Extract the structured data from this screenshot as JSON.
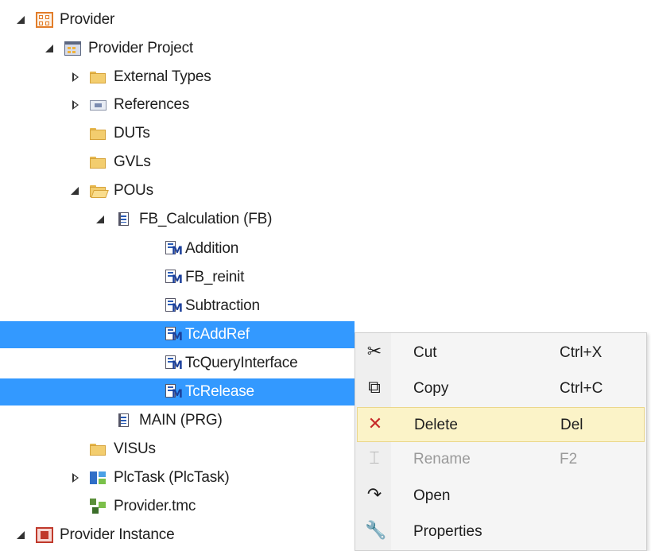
{
  "tree": {
    "items": [
      {
        "label": "Provider",
        "expander": "expanded",
        "icon": "provider-icon",
        "selected": false
      },
      {
        "label": "Provider Project",
        "expander": "expanded",
        "icon": "project-icon",
        "selected": false
      },
      {
        "label": "External Types",
        "expander": "collapsed",
        "icon": "folder-icon",
        "selected": false
      },
      {
        "label": "References",
        "expander": "collapsed",
        "icon": "references-icon",
        "selected": false
      },
      {
        "label": "DUTs",
        "expander": "none",
        "icon": "folder-icon",
        "selected": false
      },
      {
        "label": "GVLs",
        "expander": "none",
        "icon": "folder-icon",
        "selected": false
      },
      {
        "label": "POUs",
        "expander": "expanded",
        "icon": "folder-open-icon",
        "selected": false
      },
      {
        "label": "FB_Calculation (FB)",
        "expander": "expanded",
        "icon": "function-block-icon",
        "selected": false
      },
      {
        "label": "Addition",
        "expander": "none",
        "icon": "method-icon",
        "selected": false
      },
      {
        "label": "FB_reinit",
        "expander": "none",
        "icon": "method-icon",
        "selected": false
      },
      {
        "label": "Subtraction",
        "expander": "none",
        "icon": "method-icon",
        "selected": false
      },
      {
        "label": "TcAddRef",
        "expander": "none",
        "icon": "method-icon",
        "selected": true
      },
      {
        "label": "TcQueryInterface",
        "expander": "none",
        "icon": "method-icon",
        "selected": false
      },
      {
        "label": "TcRelease",
        "expander": "none",
        "icon": "method-icon",
        "selected": true
      },
      {
        "label": "MAIN (PRG)",
        "expander": "none",
        "icon": "program-icon",
        "selected": false
      },
      {
        "label": "VISUs",
        "expander": "none",
        "icon": "folder-icon",
        "selected": false
      },
      {
        "label": "PlcTask (PlcTask)",
        "expander": "collapsed",
        "icon": "task-icon",
        "selected": false
      },
      {
        "label": "Provider.tmc",
        "expander": "none",
        "icon": "tmc-icon",
        "selected": false
      },
      {
        "label": "Provider Instance",
        "expander": "expanded",
        "icon": "instance-icon",
        "selected": false
      }
    ]
  },
  "context_menu": {
    "items": [
      {
        "label": "Cut",
        "shortcut": "Ctrl+X",
        "icon": "scissors-icon",
        "glyph": "✂",
        "disabled": false,
        "highlighted": false
      },
      {
        "label": "Copy",
        "shortcut": "Ctrl+C",
        "icon": "copy-icon",
        "glyph": "⧉",
        "disabled": false,
        "highlighted": false
      },
      {
        "label": "Delete",
        "shortcut": "Del",
        "icon": "delete-icon",
        "glyph": "✕",
        "disabled": false,
        "highlighted": true
      },
      {
        "label": "Rename",
        "shortcut": "F2",
        "icon": "rename-icon",
        "glyph": "⌶",
        "disabled": true,
        "highlighted": false
      },
      {
        "label": "Open",
        "shortcut": "",
        "icon": "open-icon",
        "glyph": "↷",
        "disabled": false,
        "highlighted": false
      },
      {
        "label": "Properties",
        "shortcut": "",
        "icon": "wrench-icon",
        "glyph": "🔧",
        "disabled": false,
        "highlighted": false
      }
    ]
  },
  "colors": {
    "selection": "#3399ff",
    "menu_highlight": "#fbf3c8",
    "delete_icon": "#c62828"
  }
}
